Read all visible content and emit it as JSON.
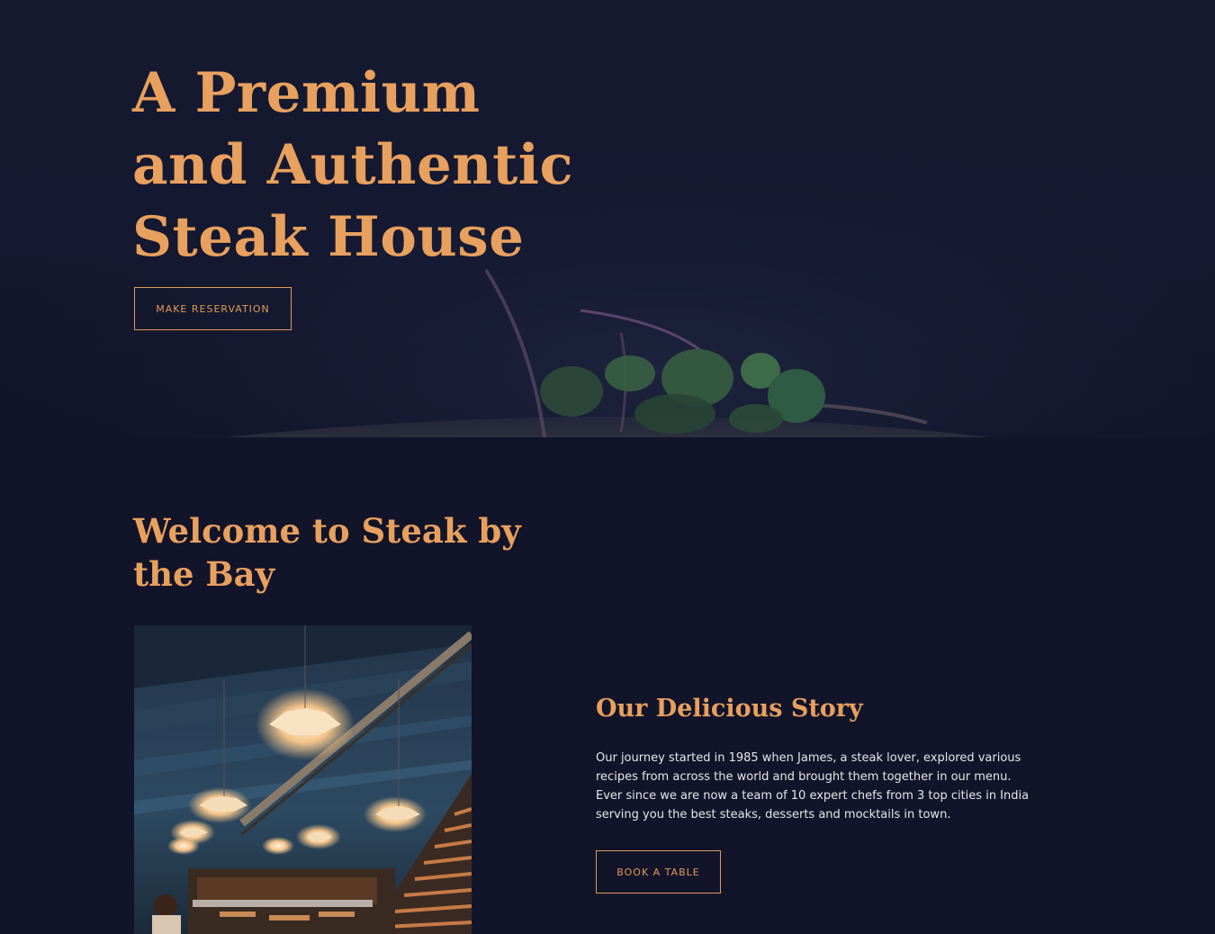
{
  "hero": {
    "title_lines": [
      "A Premium",
      "and Authentic",
      "Steak House"
    ],
    "button_label": "MAKE RESERVATION"
  },
  "welcome": {
    "title_lines": [
      "Welcome to Steak by",
      "the Bay"
    ]
  },
  "story": {
    "title": "Our Delicious Story",
    "text": "Our journey started in 1985 when James, a steak lover, explored various recipes from across the world and brought them together in our menu. Ever since we are now a team of 10 expert chefs from 3 top cities in India serving you the best steaks, desserts and mocktails in town.",
    "button_label": "BOOK A TABLE"
  },
  "colors": {
    "background": "#12142a",
    "accent": "#e8a05e",
    "body_text": "#e6e6ea"
  }
}
